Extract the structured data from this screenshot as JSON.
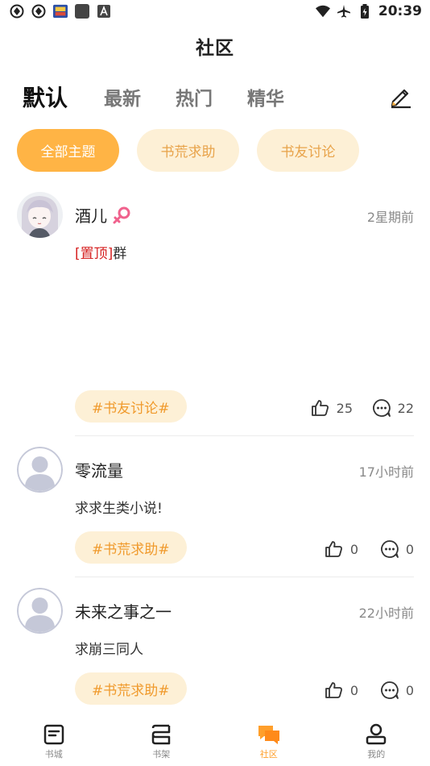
{
  "status_bar": {
    "time": "20:39"
  },
  "header": {
    "title": "社区"
  },
  "tabs": [
    {
      "label": "默认",
      "active": true
    },
    {
      "label": "最新",
      "active": false
    },
    {
      "label": "热门",
      "active": false
    },
    {
      "label": "精华",
      "active": false
    }
  ],
  "filters": [
    {
      "label": "全部主题",
      "active": true
    },
    {
      "label": "书荒求助",
      "active": false
    },
    {
      "label": "书友讨论",
      "active": false
    }
  ],
  "posts": [
    {
      "user": "酒儿",
      "time": "2星期前",
      "pinned_label": "[置顶]",
      "content": "群",
      "tag": "#书友讨论#",
      "likes": "25",
      "comments": "22",
      "gender_icon": "female-icon"
    },
    {
      "user": "零流量",
      "time": "17小时前",
      "content": "求求生类小说!",
      "tag": "#书荒求助#",
      "likes": "0",
      "comments": "0"
    },
    {
      "user": "未来之事之一",
      "time": "22小时前",
      "content": "求崩三同人",
      "tag": "#书荒求助#",
      "likes": "0",
      "comments": "0"
    }
  ],
  "bottom_nav": [
    {
      "label": "书城",
      "icon": "bookstore-icon",
      "active": false
    },
    {
      "label": "书架",
      "icon": "bookshelf-icon",
      "active": false
    },
    {
      "label": "社区",
      "icon": "community-icon",
      "active": true
    },
    {
      "label": "我的",
      "icon": "profile-icon",
      "active": false
    }
  ],
  "colors": {
    "accent": "#ffb445",
    "chip_bg": "#fdf0d6",
    "tag_text": "#f09a2c",
    "pin": "#d62222",
    "nav_active": "#ff9f2b"
  }
}
